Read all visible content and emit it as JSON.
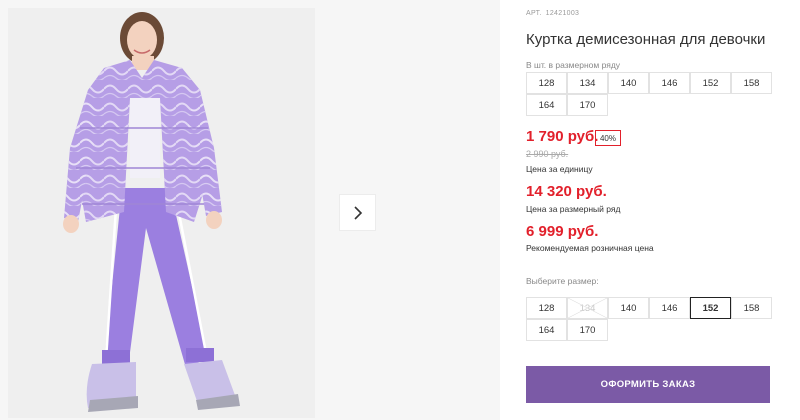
{
  "product": {
    "article_label": "АРТ.",
    "article": "12421003",
    "title": "Куртка демисезонная для девочки"
  },
  "row_sizes": {
    "label": "В шт. в размерном ряду",
    "sizes": [
      "128",
      "134",
      "140",
      "146",
      "152",
      "158",
      "164",
      "170"
    ]
  },
  "pricing": {
    "unit_price": "1 790 руб.",
    "discount": "40%",
    "old_price": "2 990 руб.",
    "unit_label": "Цена за единицу",
    "row_price": "14 320 руб.",
    "row_label": "Цена за размерный ряд",
    "retail_price": "6 999 руб.",
    "retail_label": "Рекомендуемая розничная цена"
  },
  "size_picker": {
    "label": "Выберите размер:",
    "sizes": [
      "128",
      "134",
      "140",
      "146",
      "152",
      "158",
      "164",
      "170"
    ],
    "selected": "152",
    "unavailable": [
      "134"
    ]
  },
  "order_button": "ОФОРМИТЬ ЗАКАЗ",
  "colors": {
    "accent_purple": "#7b5aa6",
    "price_red": "#e2202b",
    "jacket": "#b69ee6",
    "pants": "#9b7fe0"
  },
  "icons": {
    "next": "chevron-right-icon"
  }
}
